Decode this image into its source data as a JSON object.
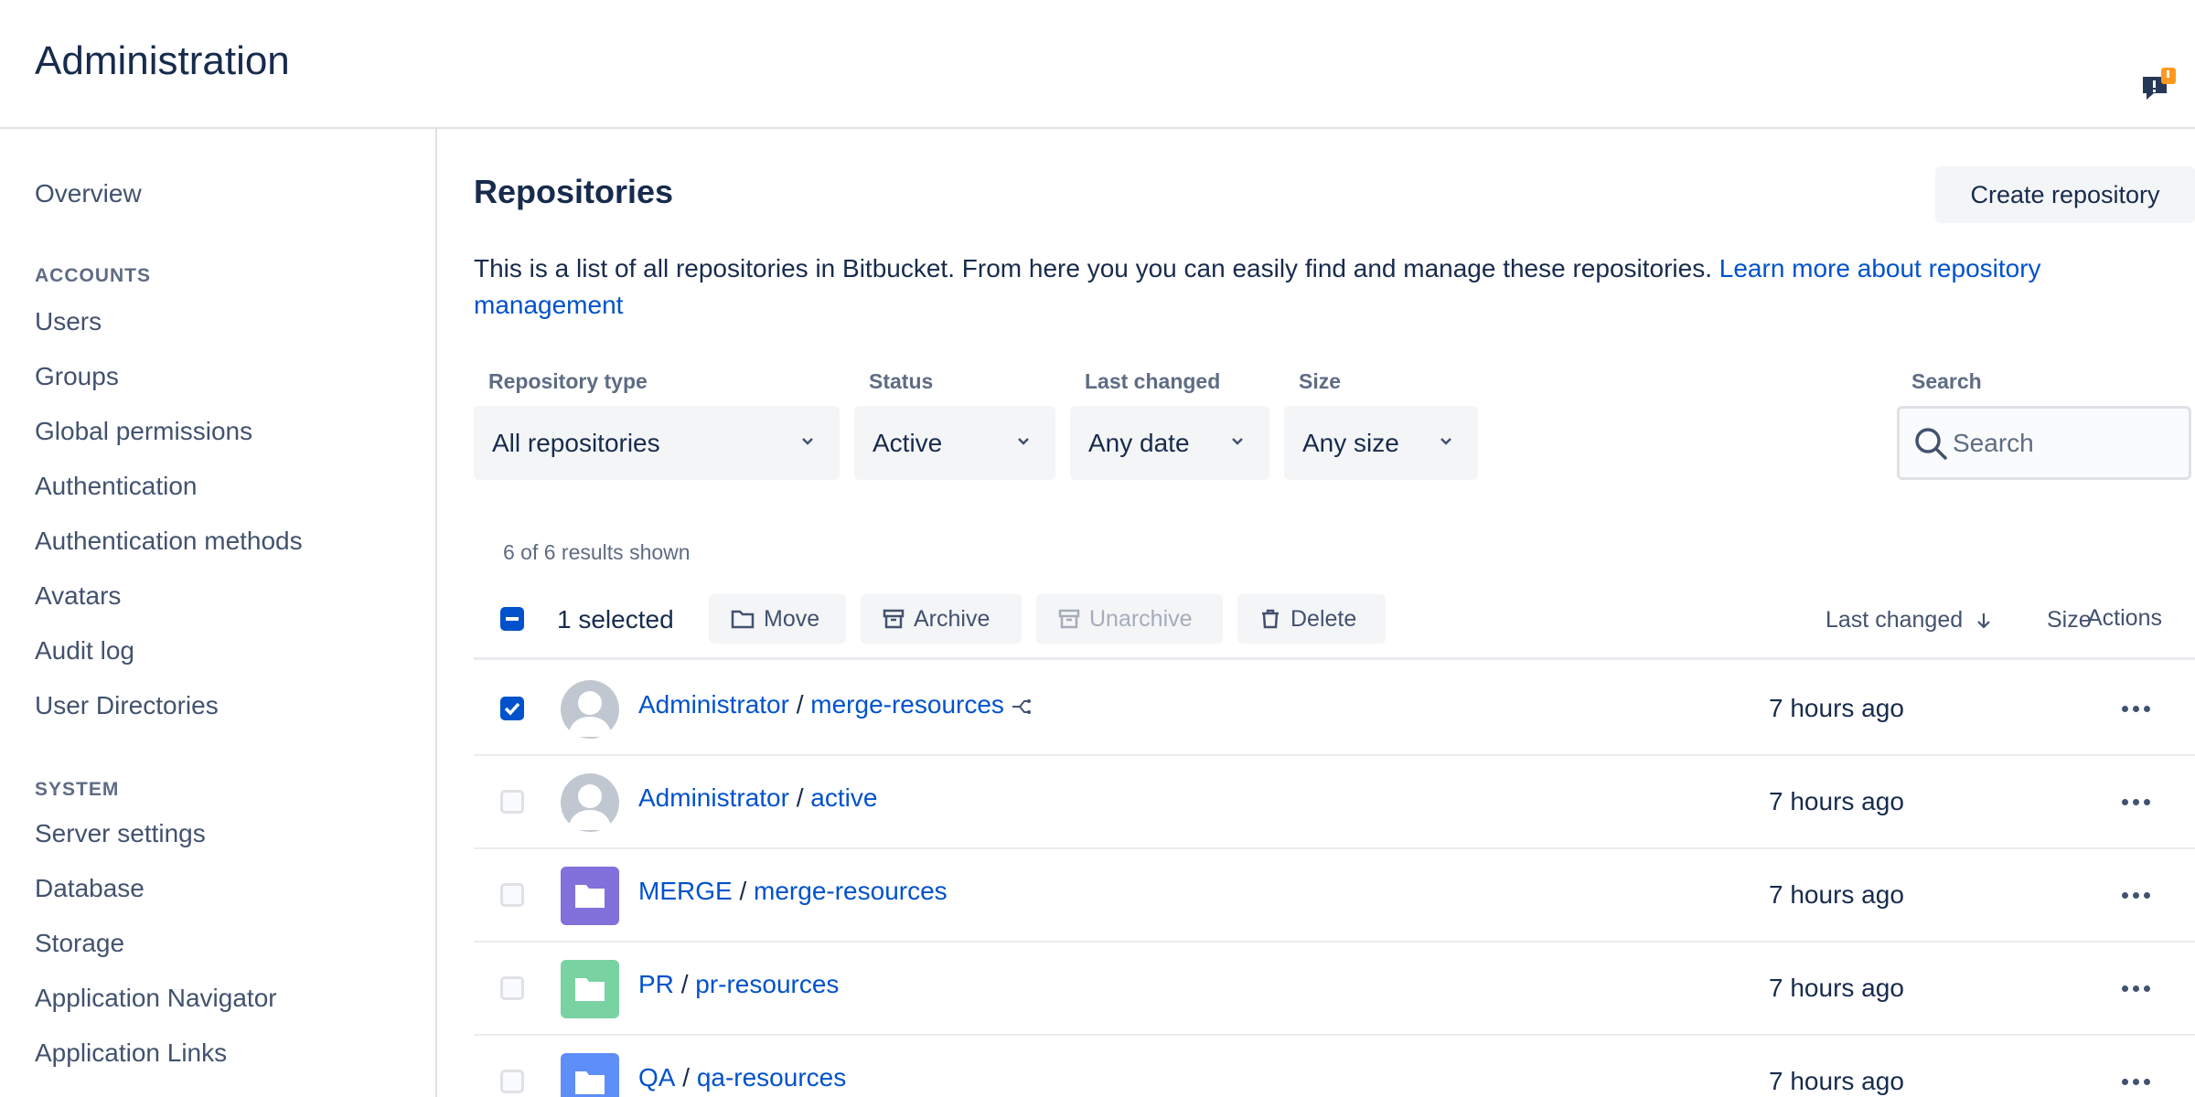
{
  "header": {
    "title": "Administration",
    "feedback_badge": "!"
  },
  "sidebar": {
    "overview": "Overview",
    "accounts_heading": "ACCOUNTS",
    "accounts": [
      "Users",
      "Groups",
      "Global permissions",
      "Authentication",
      "Authentication methods",
      "Avatars",
      "Audit log",
      "User Directories"
    ],
    "system_heading": "SYSTEM",
    "system": [
      "Server settings",
      "Database",
      "Storage",
      "Application Navigator",
      "Application Links"
    ]
  },
  "main": {
    "title": "Repositories",
    "create_button": "Create repository",
    "description": "This is a list of all repositories in Bitbucket. From here you you can easily find and manage these repositories.",
    "learn_more_1": "Learn more about repository",
    "learn_more_2": "management"
  },
  "filters": {
    "type_label": "Repository type",
    "type_value": "All repositories",
    "status_label": "Status",
    "status_value": "Active",
    "changed_label": "Last changed",
    "changed_value": "Any date",
    "size_label": "Size",
    "size_value": "Any size",
    "search_label": "Search",
    "search_placeholder": "Search"
  },
  "table": {
    "results_count": "6 of 6 results shown",
    "selected": "1 selected",
    "move": "Move",
    "archive": "Archive",
    "unarchive": "Unarchive",
    "delete": "Delete",
    "col_size": "Size",
    "col_last_changed": "Last changed",
    "col_actions": "Actions",
    "sep": "/",
    "rows": [
      {
        "owner": "Administrator",
        "repo": "merge-resources",
        "time": "7 hours ago",
        "checked": true,
        "icon": "user-avatar",
        "fork": true
      },
      {
        "owner": "Administrator",
        "repo": "active",
        "time": "7 hours ago",
        "checked": false,
        "icon": "user-avatar"
      },
      {
        "owner": "MERGE",
        "repo": "merge-resources",
        "time": "7 hours ago",
        "checked": false,
        "icon": "folder-icon",
        "color": "#8270db"
      },
      {
        "owner": "PR",
        "repo": "pr-resources",
        "time": "7 hours ago",
        "checked": false,
        "icon": "folder-icon",
        "color": "#79d2a2"
      },
      {
        "owner": "QA",
        "repo": "qa-resources",
        "time": "7 hours ago",
        "checked": false,
        "icon": "folder-icon",
        "color": "#5e8ef7"
      }
    ]
  },
  "colors": {
    "link": "#0052cc",
    "badge": "#ff991f"
  }
}
